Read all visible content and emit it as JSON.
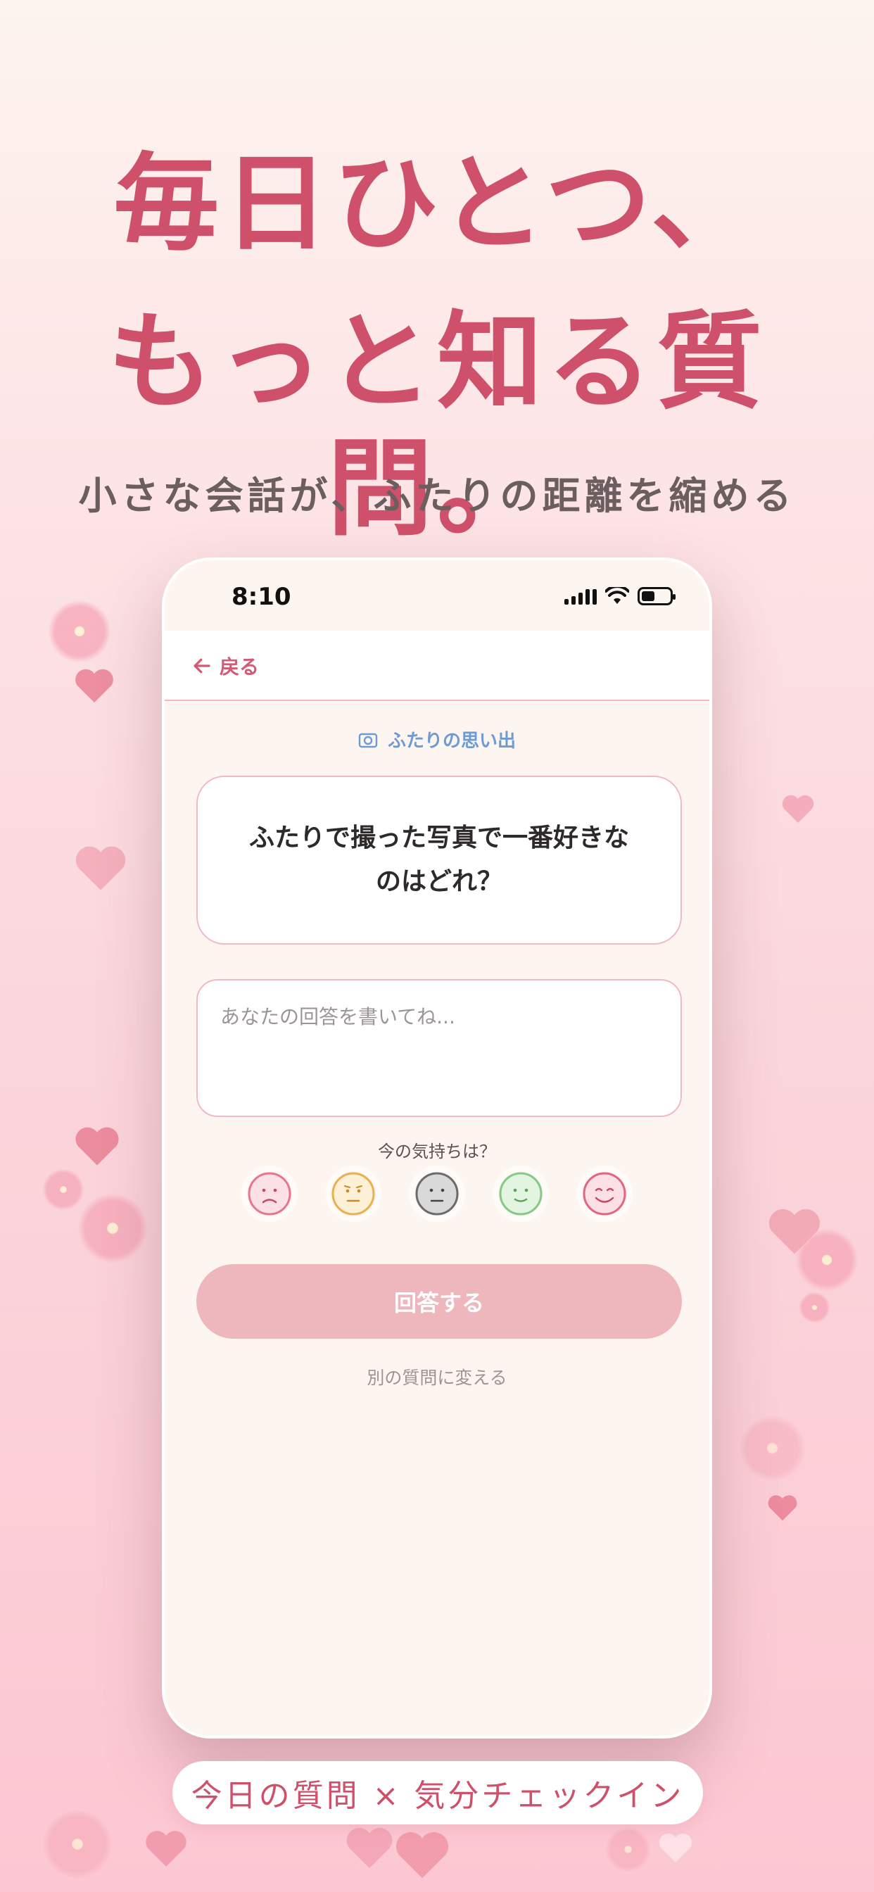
{
  "promo": {
    "headline_line1": "毎日ひとつ、",
    "headline_line2": "もっと知る質問。",
    "subheadline": "小さな会話が、ふたりの距離を縮める",
    "footer_pill": "今日の質問 × 気分チェックイン"
  },
  "status_bar": {
    "time": "8:10"
  },
  "nav": {
    "back_label": "戻る"
  },
  "question": {
    "category": "ふたりの思い出",
    "text": "ふたりで撮った写真で一番好きなのはどれ？"
  },
  "answer": {
    "placeholder": "あなたの回答を書いてね..."
  },
  "mood": {
    "label": "今の気持ちは？",
    "options": [
      {
        "name": "sad",
        "color": "#e8768a"
      },
      {
        "name": "worried",
        "color": "#eab04f"
      },
      {
        "name": "neutral",
        "color": "#6b6b6b"
      },
      {
        "name": "calm",
        "color": "#86c986"
      },
      {
        "name": "happy",
        "color": "#e0677f"
      }
    ]
  },
  "actions": {
    "submit_label": "回答する",
    "change_question_label": "別の質問に変える"
  },
  "colors": {
    "accent": "#cf506a",
    "category_blue": "#6f9bd3",
    "submit_disabled": "#edb7bd"
  }
}
